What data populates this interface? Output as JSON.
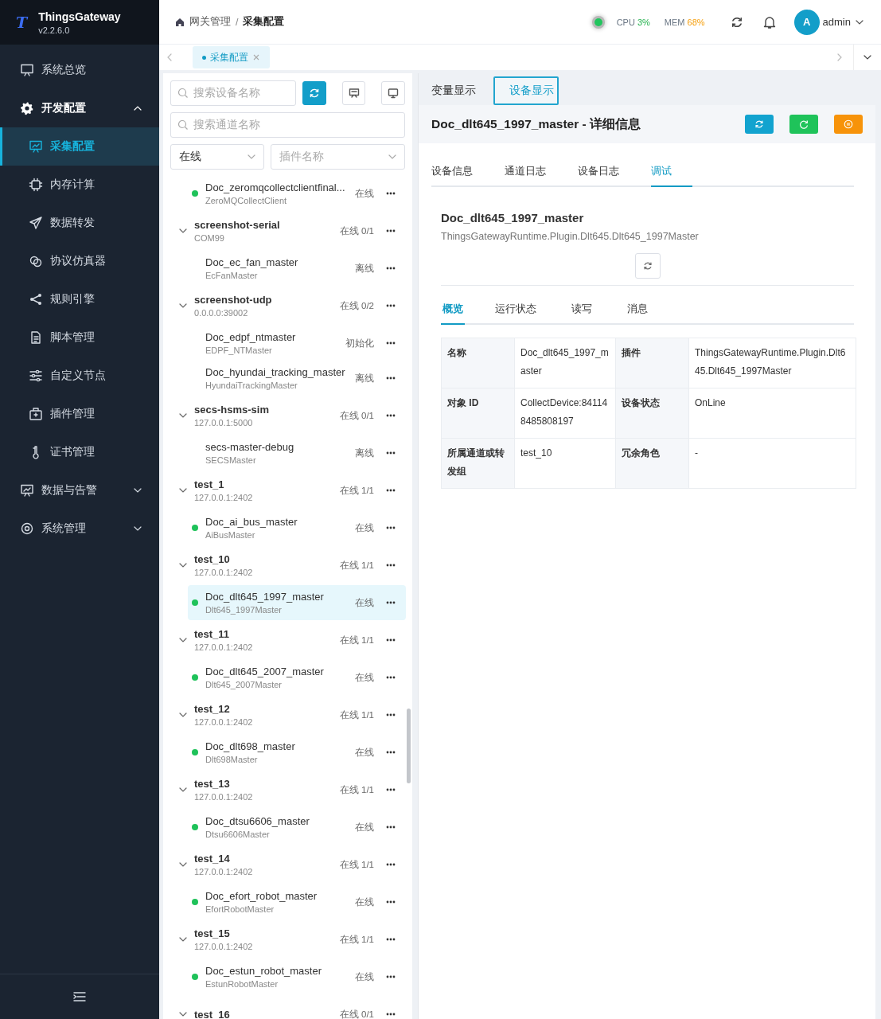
{
  "sidebar": {
    "logo_letter": "T",
    "app_name": "ThingsGateway",
    "version": "v2.2.6.0",
    "items": [
      {
        "label": "系统总览",
        "kind": "item",
        "selected": false
      },
      {
        "label": "开发配置",
        "kind": "group",
        "expanded": true,
        "children": [
          {
            "label": "采集配置",
            "selected": true
          },
          {
            "label": "内存计算",
            "selected": false
          },
          {
            "label": "数据转发",
            "selected": false
          },
          {
            "label": "协议仿真器",
            "selected": false
          },
          {
            "label": "规则引擎",
            "selected": false
          },
          {
            "label": "脚本管理",
            "selected": false
          },
          {
            "label": "自定义节点",
            "selected": false
          },
          {
            "label": "插件管理",
            "selected": false
          },
          {
            "label": "证书管理",
            "selected": false
          }
        ]
      },
      {
        "label": "数据与告警",
        "kind": "group",
        "expanded": false
      },
      {
        "label": "系统管理",
        "kind": "group",
        "expanded": false
      }
    ]
  },
  "header": {
    "breadcrumb": [
      "网关管理",
      "采集配置"
    ],
    "breadcrumb_separator": "/",
    "cpu_label": "CPU",
    "cpu_value": "3%",
    "mem_label": "MEM",
    "mem_value": "68%",
    "user_initial": "A",
    "user_name": "admin"
  },
  "page_tabs": [
    {
      "label": "采集配置",
      "selected": true
    }
  ],
  "filters": {
    "device_search": {
      "placeholder": "搜索设备名称"
    },
    "channel_search": {
      "placeholder": "搜索通道名称"
    },
    "status_select": {
      "value": "在线"
    },
    "plugin_select": {
      "placeholder": "插件名称"
    }
  },
  "tree": [
    {
      "kind": "device",
      "name": "Doc_zeromqcollectclientfinal...",
      "plugin": "ZeroMQCollectClient",
      "status": "在线",
      "online": true,
      "selected": false
    },
    {
      "kind": "channel",
      "name": "screenshot-serial",
      "address": "COM99",
      "status": "在线 0/1",
      "expanded": true,
      "children": [
        {
          "kind": "device",
          "name": "Doc_ec_fan_master",
          "plugin": "EcFanMaster",
          "status": "离线",
          "online": false,
          "selected": false
        }
      ]
    },
    {
      "kind": "channel",
      "name": "screenshot-udp",
      "address": "0.0.0.0:39002",
      "status": "在线 0/2",
      "expanded": true,
      "children": [
        {
          "kind": "device",
          "name": "Doc_edpf_ntmaster",
          "plugin": "EDPF_NTMaster",
          "status": "初始化",
          "online": false,
          "selected": false
        },
        {
          "kind": "device",
          "name": "Doc_hyundai_tracking_master",
          "plugin": "HyundaiTrackingMaster",
          "status": "离线",
          "online": false,
          "selected": false
        }
      ]
    },
    {
      "kind": "channel",
      "name": "secs-hsms-sim",
      "address": "127.0.0.1:5000",
      "status": "在线 0/1",
      "expanded": true,
      "children": [
        {
          "kind": "device",
          "name": "secs-master-debug",
          "plugin": "SECSMaster",
          "status": "离线",
          "online": false,
          "selected": false
        }
      ]
    },
    {
      "kind": "channel",
      "name": "test_1",
      "address": "127.0.0.1:2402",
      "status": "在线 1/1",
      "expanded": true,
      "children": [
        {
          "kind": "device",
          "name": "Doc_ai_bus_master",
          "plugin": "AiBusMaster",
          "status": "在线",
          "online": true,
          "selected": false
        }
      ]
    },
    {
      "kind": "channel",
      "name": "test_10",
      "address": "127.0.0.1:2402",
      "status": "在线 1/1",
      "expanded": true,
      "children": [
        {
          "kind": "device",
          "name": "Doc_dlt645_1997_master",
          "plugin": "Dlt645_1997Master",
          "status": "在线",
          "online": true,
          "selected": true
        }
      ]
    },
    {
      "kind": "channel",
      "name": "test_11",
      "address": "127.0.0.1:2402",
      "status": "在线 1/1",
      "expanded": true,
      "children": [
        {
          "kind": "device",
          "name": "Doc_dlt645_2007_master",
          "plugin": "Dlt645_2007Master",
          "status": "在线",
          "online": true,
          "selected": false
        }
      ]
    },
    {
      "kind": "channel",
      "name": "test_12",
      "address": "127.0.0.1:2402",
      "status": "在线 1/1",
      "expanded": true,
      "children": [
        {
          "kind": "device",
          "name": "Doc_dlt698_master",
          "plugin": "Dlt698Master",
          "status": "在线",
          "online": true,
          "selected": false
        }
      ]
    },
    {
      "kind": "channel",
      "name": "test_13",
      "address": "127.0.0.1:2402",
      "status": "在线 1/1",
      "expanded": true,
      "children": [
        {
          "kind": "device",
          "name": "Doc_dtsu6606_master",
          "plugin": "Dtsu6606Master",
          "status": "在线",
          "online": true,
          "selected": false
        }
      ]
    },
    {
      "kind": "channel",
      "name": "test_14",
      "address": "127.0.0.1:2402",
      "status": "在线 1/1",
      "expanded": true,
      "children": [
        {
          "kind": "device",
          "name": "Doc_efort_robot_master",
          "plugin": "EfortRobotMaster",
          "status": "在线",
          "online": true,
          "selected": false
        }
      ]
    },
    {
      "kind": "channel",
      "name": "test_15",
      "address": "127.0.0.1:2402",
      "status": "在线 1/1",
      "expanded": true,
      "children": [
        {
          "kind": "device",
          "name": "Doc_estun_robot_master",
          "plugin": "EstunRobotMaster",
          "status": "在线",
          "online": true,
          "selected": false
        }
      ]
    },
    {
      "kind": "channel",
      "name": "test_16",
      "status": "在线 0/1",
      "expanded": true
    }
  ],
  "view_tabs": [
    {
      "label": "变量显示",
      "selected": false
    },
    {
      "label": "设备显示",
      "selected": true
    }
  ],
  "detail": {
    "title": "Doc_dlt645_1997_master - 详细信息",
    "tabs": [
      {
        "label": "设备信息",
        "selected": false
      },
      {
        "label": "通道日志",
        "selected": false
      },
      {
        "label": "设备日志",
        "selected": false
      },
      {
        "label": "调试",
        "selected": true
      }
    ],
    "device_name": "Doc_dlt645_1997_master",
    "plugin_path": "ThingsGatewayRuntime.Plugin.Dlt645.Dlt645_1997Master",
    "sub_tabs": [
      {
        "label": "概览",
        "selected": true
      },
      {
        "label": "运行状态",
        "selected": false
      },
      {
        "label": "读写",
        "selected": false
      },
      {
        "label": "消息",
        "selected": false
      }
    ],
    "info": [
      [
        {
          "label": "名称",
          "value": "Doc_dlt645_1997_master"
        },
        {
          "label": "插件",
          "value": "ThingsGatewayRuntime.Plugin.Dlt645.Dlt645_1997Master"
        }
      ],
      [
        {
          "label": "对象 ID",
          "value": "CollectDevice:841148485808197"
        },
        {
          "label": "设备状态",
          "value": "OnLine"
        }
      ],
      [
        {
          "label": "所属通道或转发组",
          "value": "test_10"
        },
        {
          "label": "冗余角色",
          "value": "-"
        }
      ]
    ]
  }
}
